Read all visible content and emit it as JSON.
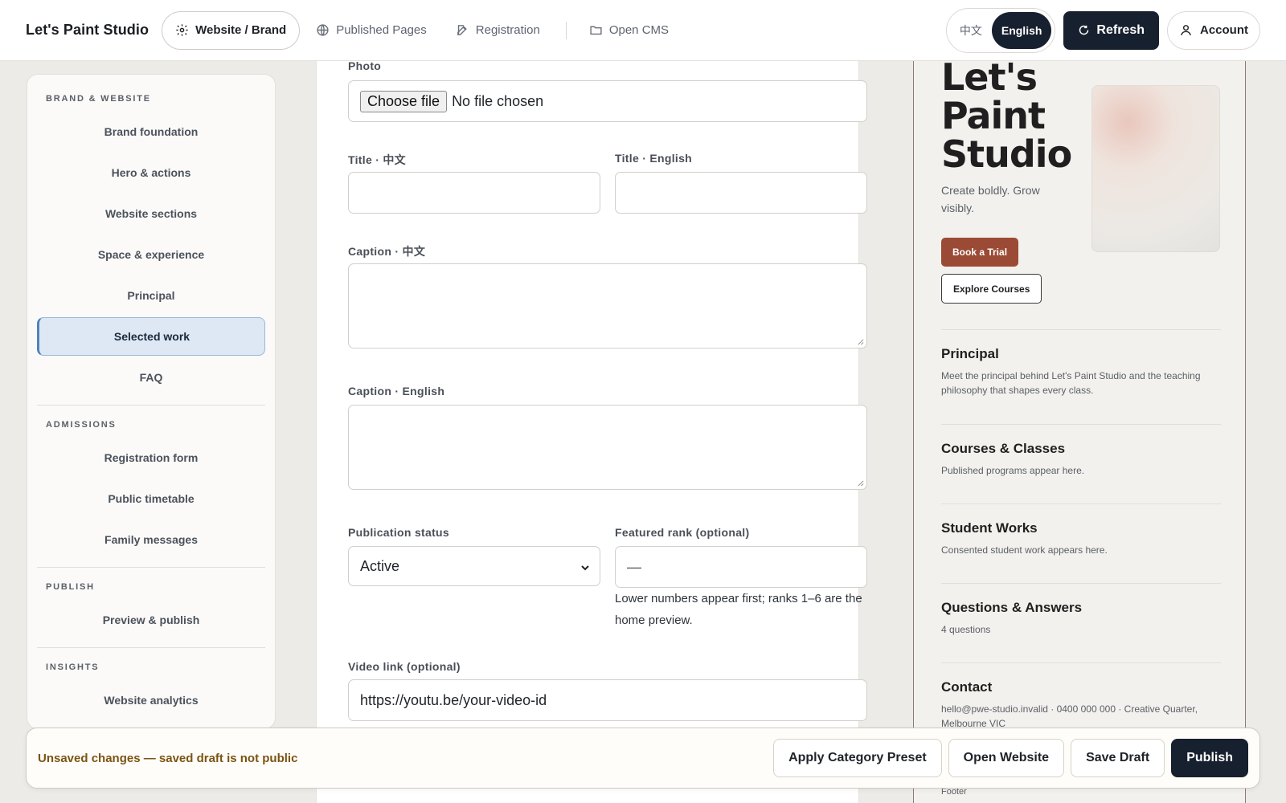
{
  "app": {
    "title": "Let's Paint Studio"
  },
  "nav": {
    "items": [
      {
        "label": "Website / Brand",
        "icon": "gear-icon",
        "active": true
      },
      {
        "label": "Published Pages",
        "icon": "globe-icon",
        "active": false
      },
      {
        "label": "Registration",
        "icon": "edit-icon",
        "active": false
      },
      {
        "label": "Open CMS",
        "icon": "folder-icon",
        "active": false
      }
    ]
  },
  "language": {
    "zh": "中文",
    "en": "English",
    "selected": "English"
  },
  "toolbar": {
    "refresh_label": "Refresh",
    "account_label": "Account"
  },
  "sidebar": {
    "groups": [
      {
        "title": "BRAND & WEBSITE",
        "items": [
          "Brand foundation",
          "Hero & actions",
          "Website sections",
          "Space & experience",
          "Principal",
          "Selected work",
          "FAQ"
        ]
      },
      {
        "title": "ADMISSIONS",
        "items": [
          "Registration form",
          "Public timetable",
          "Family messages"
        ]
      },
      {
        "title": "PUBLISH",
        "items": [
          "Preview & publish"
        ]
      },
      {
        "title": "INSIGHTS",
        "items": [
          "Website analytics"
        ]
      }
    ],
    "active_item": "Selected work"
  },
  "form": {
    "photo_label": "Photo",
    "choose_file_label": "Choose file",
    "no_file_text": "No file chosen",
    "title_zh_label": "Title · 中文",
    "title_en_label": "Title · English",
    "title_zh_value": "",
    "title_en_value": "",
    "caption_zh_label": "Caption · 中文",
    "caption_en_label": "Caption · English",
    "caption_zh_value": "",
    "caption_en_value": "",
    "status_label": "Publication status",
    "status_value": "Active",
    "rank_label": "Featured rank (optional)",
    "rank_value": "—",
    "rank_helper": "Lower numbers appear first; ranks 1–6 are the home preview.",
    "video_label": "Video link (optional)",
    "video_value": "https://youtu.be/your-video-id"
  },
  "preview": {
    "hero_title": "Let's Paint Studio",
    "tagline": "Create boldly. Grow visibly.",
    "primary_cta": "Book a Trial",
    "secondary_cta": "Explore Courses",
    "sections": [
      {
        "title": "Principal",
        "body": "Meet the principal behind Let's Paint Studio and the teaching philosophy that shapes every class."
      },
      {
        "title": "Courses & Classes",
        "body": "Published programs appear here."
      },
      {
        "title": "Student Works",
        "body": "Consented student work appears here."
      },
      {
        "title": "Questions & Answers",
        "body": "4 questions"
      },
      {
        "title": "Contact",
        "body": "hello@pwe-studio.invalid · 0400 000 000 · Creative Quarter, Melbourne VIC"
      }
    ],
    "footer": "Footer"
  },
  "action_bar": {
    "status_text": "Unsaved changes — saved draft is not public",
    "buttons": [
      "Apply Category Preset",
      "Open Website",
      "Save Draft",
      "Publish"
    ]
  },
  "colors": {
    "accent_dark": "#17202e",
    "active_sidebar": "#dde8f4",
    "preview_primary": "#9b4a35",
    "warning_text": "#7a5414"
  }
}
